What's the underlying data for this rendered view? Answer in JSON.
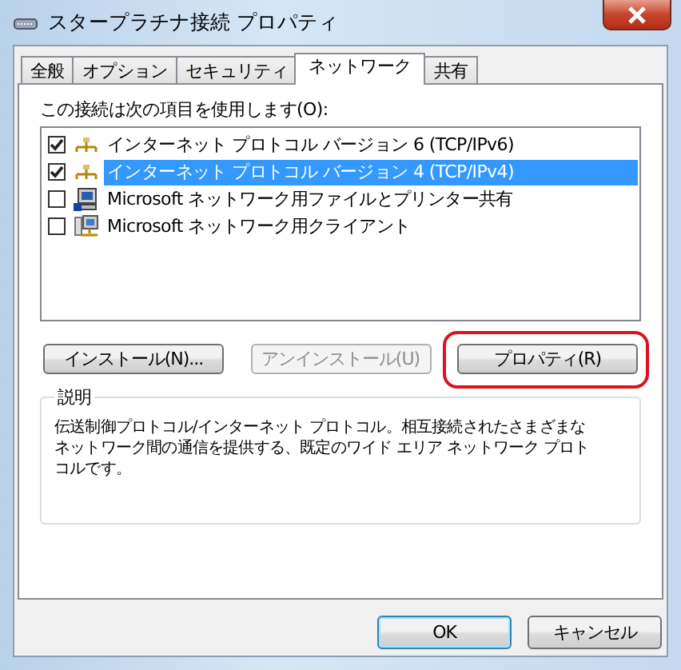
{
  "window": {
    "title": "スタープラチナ接続 プロパティ"
  },
  "tabs": [
    {
      "label": "全般",
      "selected": false
    },
    {
      "label": "オプション",
      "selected": false
    },
    {
      "label": "セキュリティ",
      "selected": false
    },
    {
      "label": "ネットワーク",
      "selected": true
    },
    {
      "label": "共有",
      "selected": false
    }
  ],
  "connection_label": "この接続は次の項目を使用します(O):",
  "components": [
    {
      "label": "インターネット プロトコル バージョン 6 (TCP/IPv6)",
      "checked": true,
      "selected": false,
      "kind": "protocol"
    },
    {
      "label": "インターネット プロトコル バージョン 4 (TCP/IPv4)",
      "checked": true,
      "selected": true,
      "kind": "protocol"
    },
    {
      "label": "Microsoft ネットワーク用ファイルとプリンター共有",
      "checked": false,
      "selected": false,
      "kind": "service"
    },
    {
      "label": "Microsoft ネットワーク用クライアント",
      "checked": false,
      "selected": false,
      "kind": "client"
    }
  ],
  "buttons": [
    {
      "label": "インストール(N)...",
      "disabled": false,
      "highlighted": false
    },
    {
      "label": "アンインストール(U)",
      "disabled": true,
      "highlighted": false
    },
    {
      "label": "プロパティ(R)",
      "disabled": false,
      "highlighted": true
    }
  ],
  "description": {
    "title": "説明",
    "lines": [
      "伝送制御プロトコル/インターネット プロトコル。相互接続されたさまざまな",
      "ネットワーク間の通信を提供する、既定のワイド エリア ネットワーク プロト",
      "コルです。"
    ]
  },
  "dialog_buttons": [
    {
      "label": "OK",
      "default": true
    },
    {
      "label": "キャンセル",
      "default": false
    }
  ]
}
